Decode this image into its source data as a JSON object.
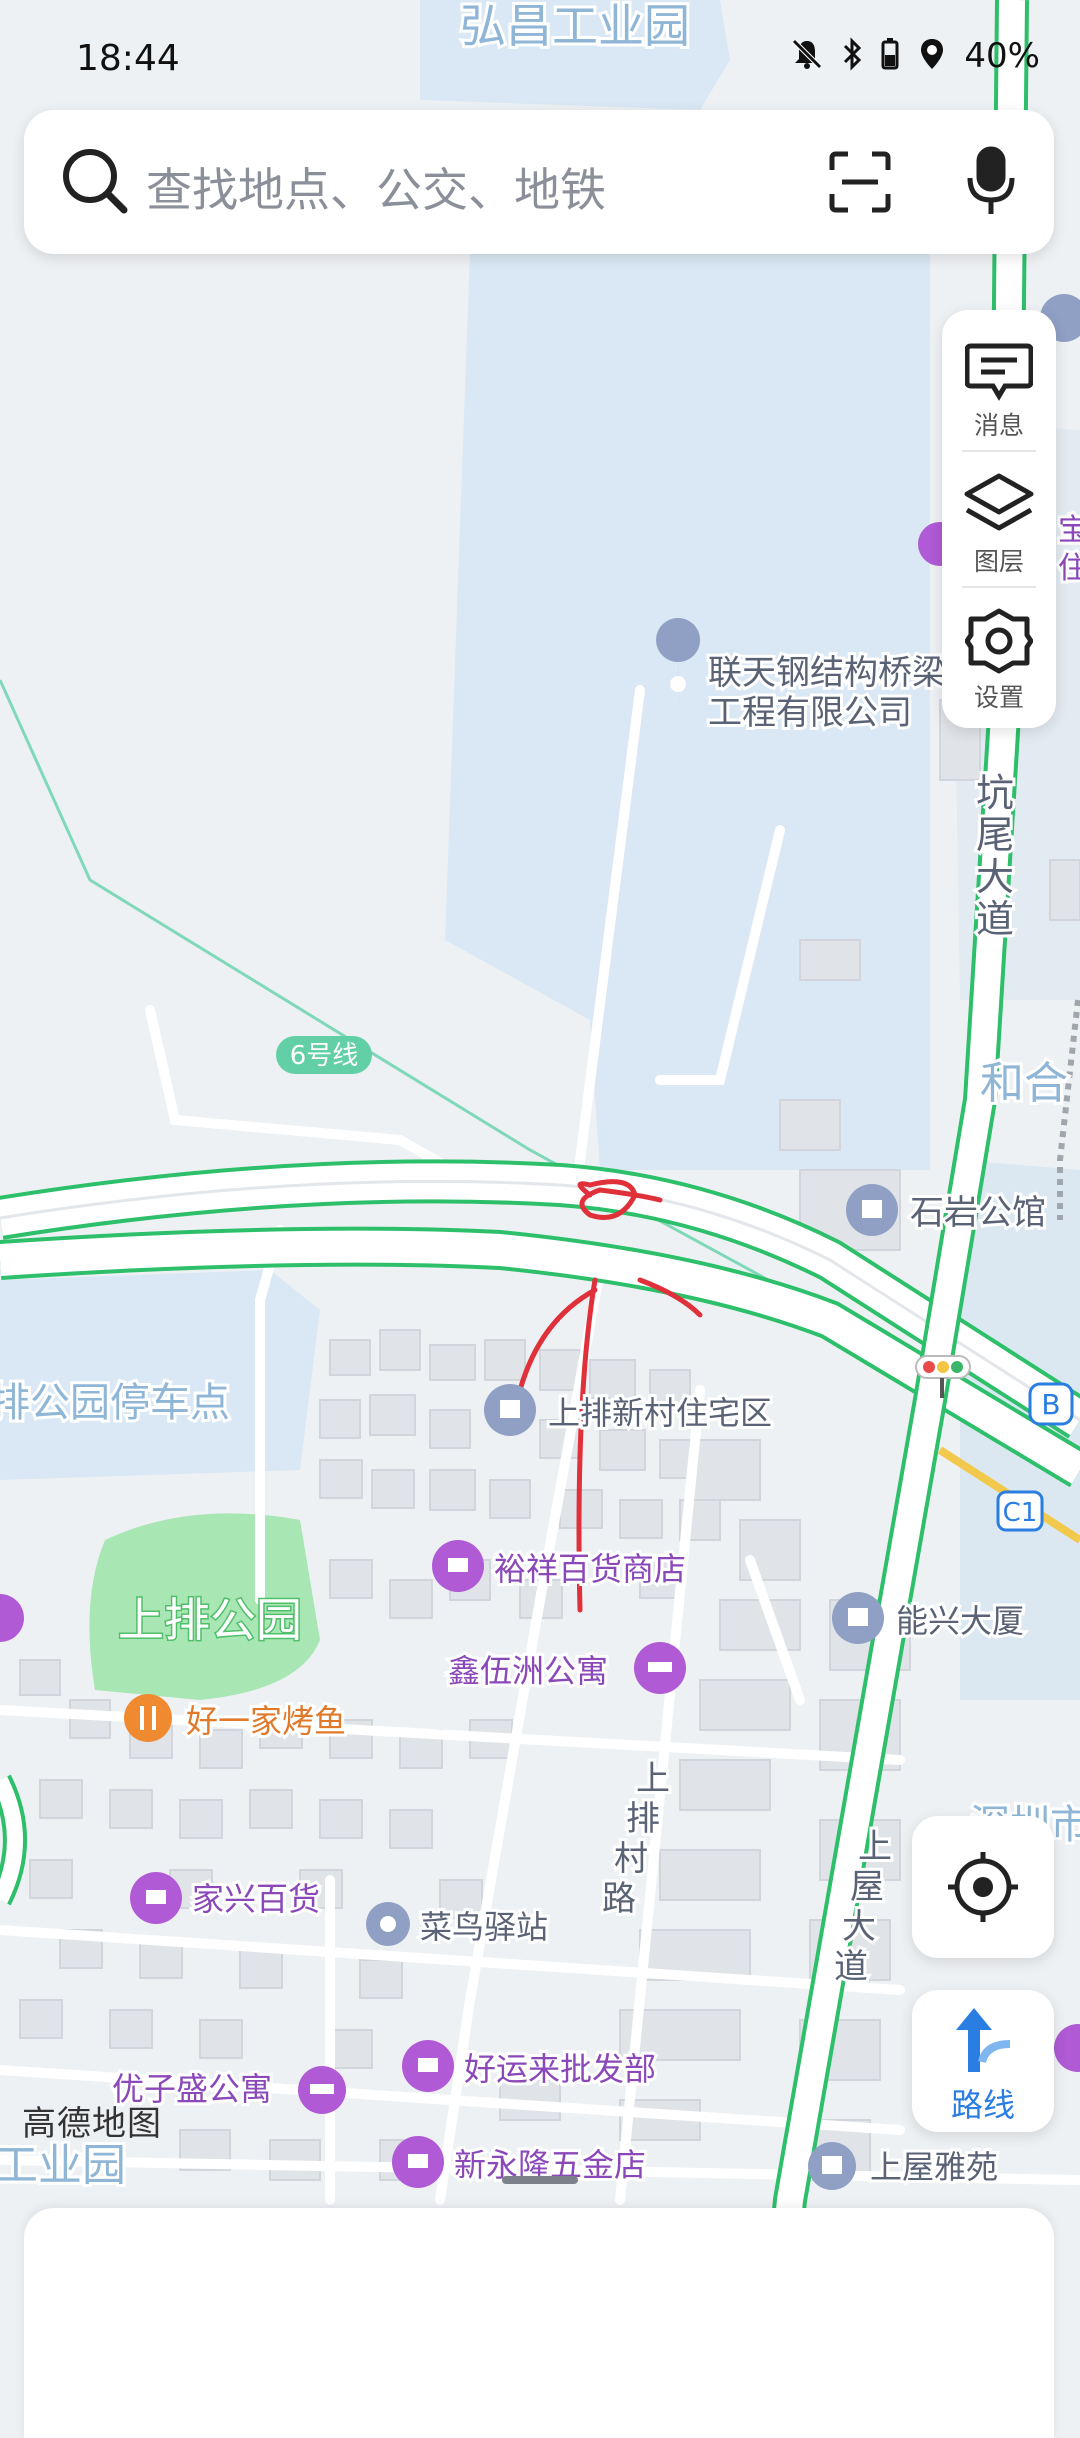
{
  "status_bar": {
    "time": "18:44",
    "battery_percent": "40%",
    "icons": [
      "bell-off-icon",
      "bluetooth-icon",
      "battery-icon",
      "location-icon"
    ]
  },
  "search": {
    "placeholder": "查找地点、公交、地铁",
    "icons": [
      "search-icon",
      "scan-icon",
      "mic-icon"
    ]
  },
  "tools": {
    "messages_label": "消息",
    "layers_label": "图层",
    "settings_label": "设置"
  },
  "buttons": {
    "route_label": "路线"
  },
  "map": {
    "logo": "高德地图",
    "labels": {
      "hongchang": "弘昌工业园",
      "liantian_line1": "联天钢结构桥梁",
      "liantian_line2": "工程有限公司",
      "kengwei_1": "坑",
      "kengwei_2": "尾",
      "kengwei_3": "大",
      "kengwei_4": "道",
      "line6": "6号线",
      "hehe": "和合",
      "shiyan": "石岩公馆",
      "parking": "排公园停车点",
      "shangpai_village": "上排新村住宅区",
      "yuxiang": "裕祥百货商店",
      "shangpai_park": "上排公园",
      "nengxing": "能兴大厦",
      "xinwuzhou": "鑫伍洲公寓",
      "haoyijia": "好一家烤鱼",
      "shangpai_road_1": "上",
      "shangpai_road_2": "排",
      "shangpai_road_3": "村",
      "shangpai_road_4": "路",
      "shangwu_1": "上",
      "shangwu_2": "屋",
      "shangwu_3": "大",
      "shangwu_4": "道",
      "jiaxing": "家兴百货",
      "cainiao": "菜鸟驿站",
      "youzisheng": "优子盛公寓",
      "haoyunlai": "好运来批发部",
      "gongyeyuan": "工业园",
      "xinyonglong": "新永隆五金店",
      "shangwu_yayuan": "上屋雅苑",
      "shenzhen": "深圳市",
      "bao": "宝",
      "zhu": "住",
      "badge_b": "B",
      "badge_c1": "C1"
    }
  },
  "colors": {
    "road_green": "#2dbf6a",
    "annotation_red": "#e0303a",
    "poi_purple": "#b05ad6",
    "poi_gray": "#8fa0c4",
    "route_blue": "#2a7de1",
    "water": "#d6e7f5",
    "park": "#a8e6b4"
  }
}
